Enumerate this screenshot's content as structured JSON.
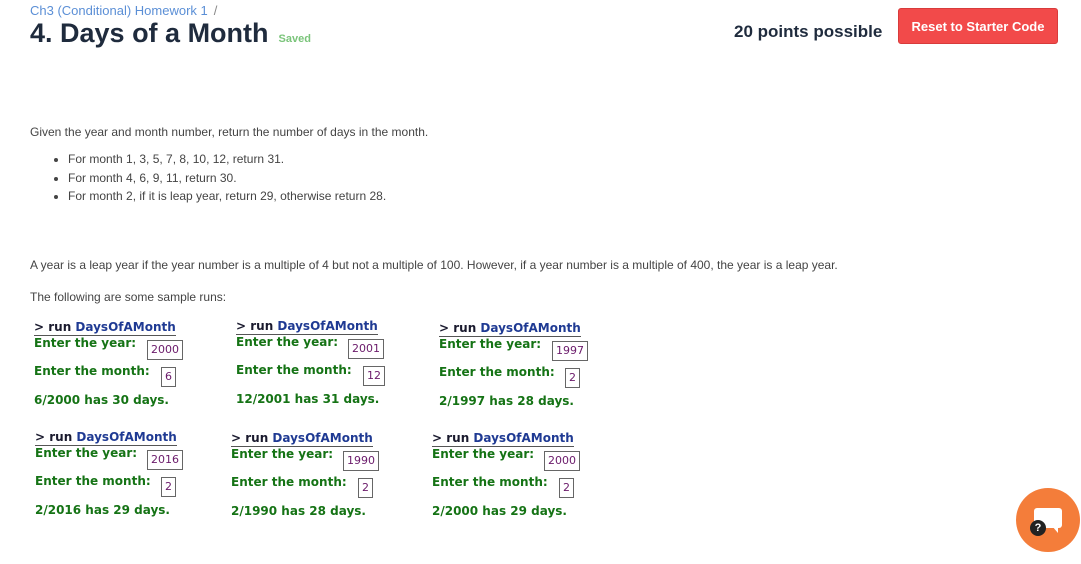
{
  "header": {
    "breadcrumb": "Ch3 (Conditional) Homework 1",
    "breadcrumb_sep": "/",
    "title": "4. Days of a Month",
    "saved": "Saved",
    "points": "20 points possible",
    "reset_label": "Reset to Starter Code"
  },
  "content": {
    "description": "Given the year and month number, return the number of days in the month.",
    "rules": [
      "For month 1, 3, 5, 7, 8, 10, 12, return 31.",
      "For month 4, 6, 9, 11, return 30.",
      "For month 2, if it is leap year, return 29, otherwise return 28."
    ],
    "leap_rule": "A year is a leap year if the year number is a multiple of 4 but not a multiple of 100. However, if a year number is a multiple of 400, the year is a leap year.",
    "samples_intro": "The following are some sample runs:"
  },
  "runs_common": {
    "prompt": "> run ",
    "program": "DaysOfAMonth",
    "year_label": "Enter the year:",
    "month_label": "Enter the month:"
  },
  "runs": [
    {
      "year": "2000",
      "month": "6",
      "result": "6/2000 has 30 days."
    },
    {
      "year": "2001",
      "month": "12",
      "result": "12/2001 has 31 days."
    },
    {
      "year": "1997",
      "month": "2",
      "result": "2/1997 has 28 days."
    },
    {
      "year": "2016",
      "month": "2",
      "result": "2/2016 has 29 days."
    },
    {
      "year": "1990",
      "month": "2",
      "result": "2/1990 has 28 days."
    },
    {
      "year": "2000",
      "month": "2",
      "result": "2/2000 has 29 days."
    }
  ],
  "chat": {
    "help_glyph": "?"
  },
  "colors": {
    "accent": "#f24a4a",
    "chat": "#f47d3a",
    "output_green": "#157315",
    "program_blue": "#1f3a93"
  }
}
